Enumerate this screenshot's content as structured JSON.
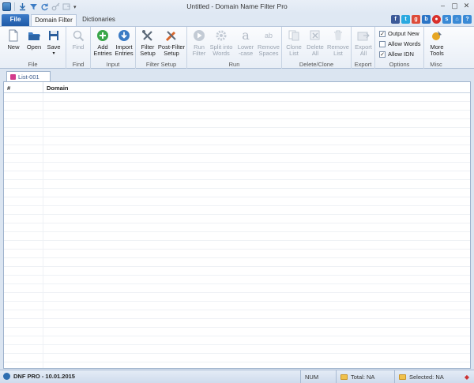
{
  "window": {
    "title": "Untitled - Domain Name Filter Pro"
  },
  "tabs": {
    "file": "File",
    "active": "Domain Filter",
    "dictionaries": "Dictionaries"
  },
  "ribbon": {
    "file": {
      "label": "File",
      "new": "New",
      "open": "Open",
      "save": "Save"
    },
    "find": {
      "label": "Find",
      "find": "Find"
    },
    "input": {
      "label": "Input",
      "add": "Add\nEntries",
      "import": "Import\nEntries"
    },
    "filter_setup": {
      "label": "Filter Setup",
      "filter": "Filter\nSetup",
      "post": "Post-Filter\nSetup"
    },
    "run": {
      "label": "Run",
      "run": "Run\nFilter",
      "split": "Split into\nWords",
      "lower": "Lower\n-case",
      "remove_spaces": "Remove\nSpaces"
    },
    "delete_clone": {
      "label": "Delete/Clone",
      "clone": "Clone\nList",
      "delete_all": "Delete\nAll",
      "remove": "Remove\nList"
    },
    "export": {
      "label": "Export",
      "export_all": "Export\nAll"
    },
    "options": {
      "label": "Options",
      "output_new": "Output New",
      "allow_words": "Allow Words",
      "allow_idn": "Allow IDN"
    },
    "misc": {
      "label": "Misc",
      "more_tools": "More\nTools"
    }
  },
  "options_state": {
    "output_new": true,
    "allow_words": false,
    "allow_idn": true
  },
  "document_tab": "List-001",
  "grid": {
    "col_num": "#",
    "col_domain": "Domain"
  },
  "status": {
    "product": "DNF PRO - 10.01.2015",
    "num": "NUM",
    "total": "Total: NA",
    "selected": "Selected: NA"
  },
  "colors": {
    "accent": "#1f5aa8",
    "ribbon_bg": "#e8eef6",
    "frame": "#dbe5f1"
  }
}
